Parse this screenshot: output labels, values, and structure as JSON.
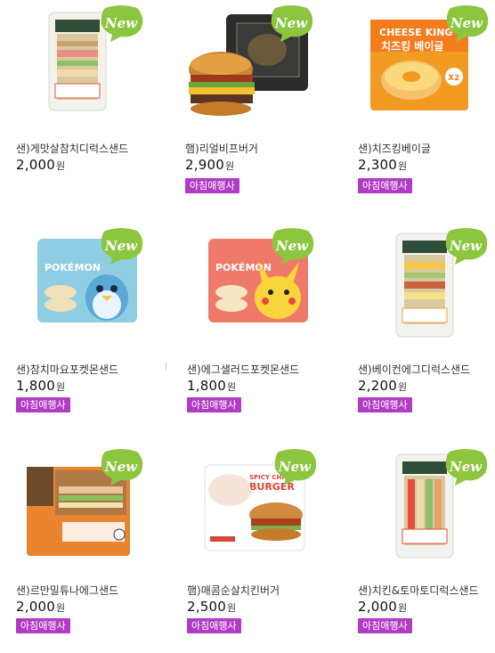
{
  "products": [
    {
      "name": "샌)게맛살참치디럭스샌드",
      "price": "2,000",
      "currency": "원",
      "badge": "New",
      "tag": "",
      "art": "triangle-sandwich",
      "accent": "#e9543f"
    },
    {
      "name": "햄)리얼비프버거",
      "price": "2,900",
      "currency": "원",
      "badge": "New",
      "tag": "아침애행사",
      "art": "burger-box",
      "accent": "#2b2b2b"
    },
    {
      "name": "샌)치즈킹베이글",
      "price": "2,300",
      "currency": "원",
      "badge": "New",
      "tag": "아침애행사",
      "art": "bagel",
      "accent": "#f08a1c"
    },
    {
      "name": "샌)참치마요포켓몬샌드",
      "price": "1,800",
      "currency": "원",
      "badge": "New",
      "tag": "아침애행사",
      "art": "pokemon-blue",
      "accent": "#7ec3dd"
    },
    {
      "name": "샌)에그샐러드포켓몬샌드",
      "price": "1,800",
      "currency": "원",
      "badge": "New",
      "tag": "아침애행사",
      "art": "pokemon-red",
      "accent": "#ef6b5e"
    },
    {
      "name": "샌)베이컨에그디럭스샌드",
      "price": "2,200",
      "currency": "원",
      "badge": "New",
      "tag": "아침애행사",
      "art": "triangle-sandwich-egg",
      "accent": "#f0a23a"
    },
    {
      "name": "샌)르만밀튜나에그샌드",
      "price": "2,000",
      "currency": "원",
      "badge": "New",
      "tag": "아침애행사",
      "art": "square-sandwich",
      "accent": "#e9842f"
    },
    {
      "name": "햄)매콤순살치킨버거",
      "price": "2,500",
      "currency": "원",
      "badge": "New",
      "tag": "아침애행사",
      "art": "chicken-burger",
      "accent": "#d8463a"
    },
    {
      "name": "샌)치킨&토마토디럭스샌드",
      "price": "2,000",
      "currency": "원",
      "badge": "New",
      "tag": "아침애행사",
      "art": "triangle-sandwich-tomato",
      "accent": "#e34f3c"
    }
  ],
  "colors": {
    "badge_green": "#8cc63f",
    "tag_purple": "#b23bc6"
  }
}
